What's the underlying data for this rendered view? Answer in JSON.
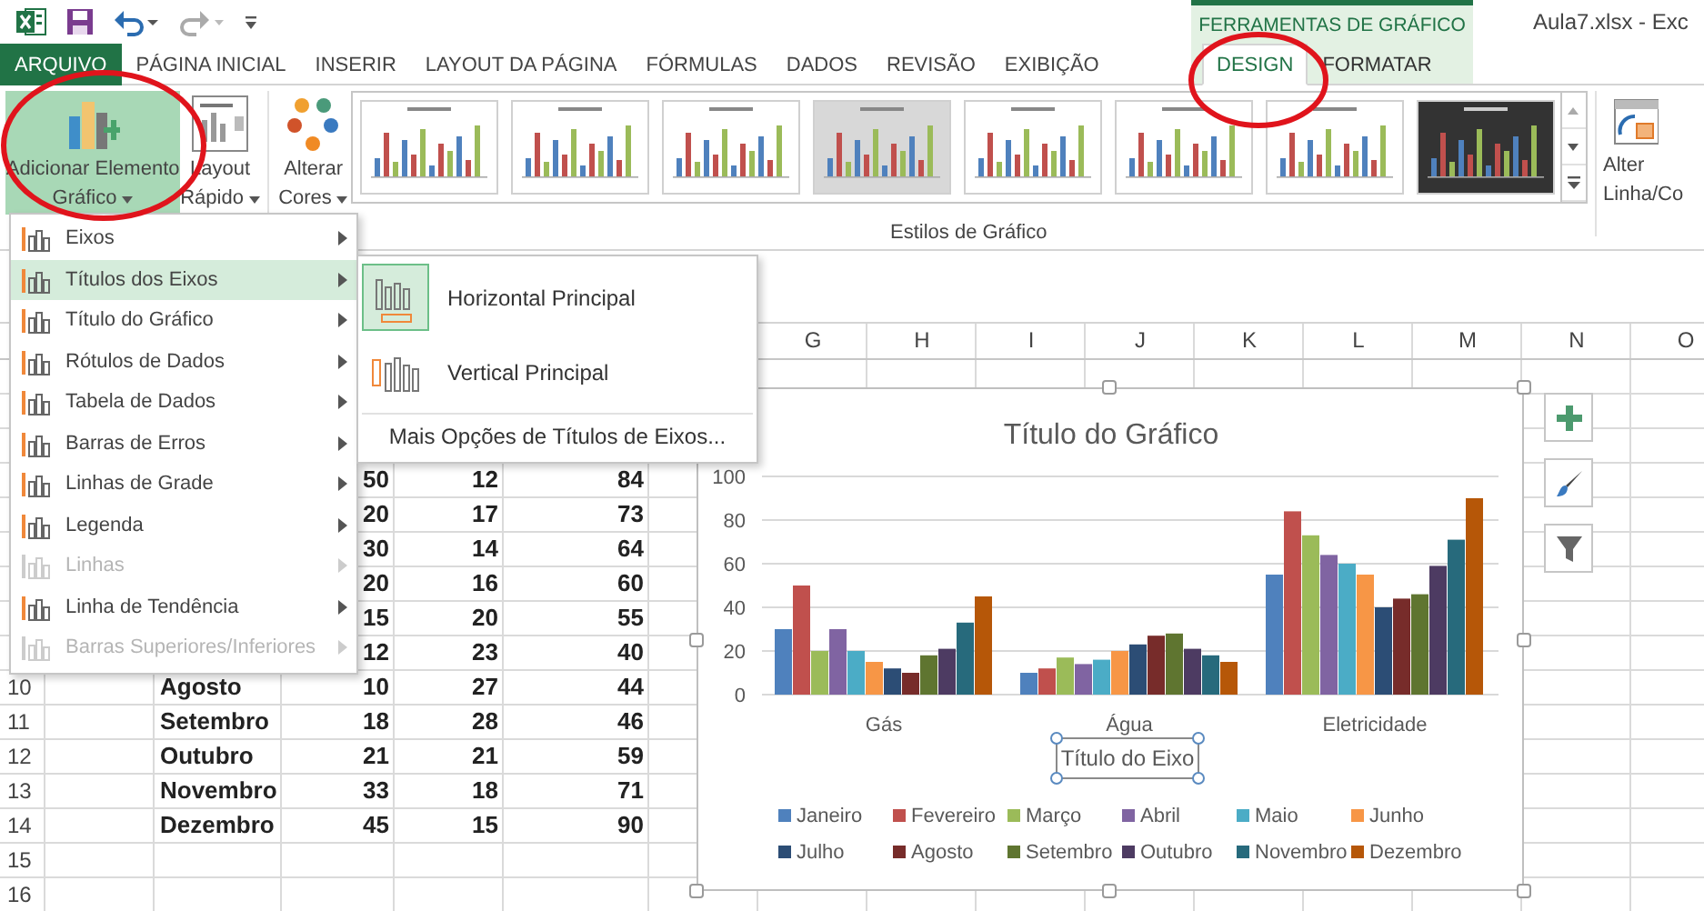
{
  "title_bar": {
    "context_header": "FERRAMENTAS DE GRÁFICO",
    "document_title": "Aula7.xlsx - Exc"
  },
  "tabs": [
    {
      "label": "ARQUIVO",
      "kind": "file",
      "selected": false
    },
    {
      "label": "PÁGINA INICIAL",
      "kind": "main",
      "selected": false
    },
    {
      "label": "INSERIR",
      "kind": "main",
      "selected": false
    },
    {
      "label": "LAYOUT DA PÁGINA",
      "kind": "main",
      "selected": false
    },
    {
      "label": "FÓRMULAS",
      "kind": "main",
      "selected": false
    },
    {
      "label": "DADOS",
      "kind": "main",
      "selected": false
    },
    {
      "label": "REVISÃO",
      "kind": "main",
      "selected": false
    },
    {
      "label": "EXIBIÇÃO",
      "kind": "main",
      "selected": false
    },
    {
      "label": "DESIGN",
      "kind": "context",
      "selected": true
    },
    {
      "label": "FORMATAR",
      "kind": "context",
      "selected": false
    }
  ],
  "ribbon": {
    "buttons": [
      {
        "kind": "add",
        "lines": [
          "Adicionar Elemento",
          "Gráfico"
        ],
        "pressed": true
      },
      {
        "kind": "layout",
        "lines": [
          "Layout",
          "Rápido"
        ],
        "pressed": false
      },
      {
        "kind": "colors",
        "lines": [
          "Alterar",
          "Cores"
        ],
        "pressed": false
      }
    ],
    "styles_gallery": [
      {
        "kind": "plain"
      },
      {
        "kind": "plain"
      },
      {
        "kind": "plain"
      },
      {
        "kind": "gray"
      },
      {
        "kind": "plain"
      },
      {
        "kind": "plain"
      },
      {
        "kind": "plain"
      },
      {
        "kind": "dark"
      }
    ],
    "group_label": "Estilos de Gráfico",
    "cut_button": {
      "lines": [
        "Alter",
        "Linha/Co"
      ]
    }
  },
  "chart_element_menu": {
    "items": [
      {
        "label": "Eixos",
        "selected": false,
        "disabled": false
      },
      {
        "label": "Títulos dos Eixos",
        "selected": true,
        "disabled": false
      },
      {
        "label": "Título do Gráfico",
        "selected": false,
        "disabled": false
      },
      {
        "label": "Rótulos de Dados",
        "selected": false,
        "disabled": false
      },
      {
        "label": "Tabela de Dados",
        "selected": false,
        "disabled": false
      },
      {
        "label": "Barras de Erros",
        "selected": false,
        "disabled": false
      },
      {
        "label": "Linhas de Grade",
        "selected": false,
        "disabled": false
      },
      {
        "label": "Legenda",
        "selected": false,
        "disabled": false
      },
      {
        "label": "Linhas",
        "selected": false,
        "disabled": true
      },
      {
        "label": "Linha de Tendência",
        "selected": false,
        "disabled": false
      },
      {
        "label": "Barras Superiores/Inferiores",
        "selected": false,
        "disabled": true
      }
    ]
  },
  "axis_titles_submenu": {
    "items": [
      {
        "label": "Horizontal Principal",
        "kind": "horizontal",
        "selected": true
      },
      {
        "label": "Vertical Principal",
        "kind": "vertical",
        "selected": false
      }
    ],
    "more_link": "Mais Opções de Títulos de Eixos..."
  },
  "sheet": {
    "columns": [
      "G",
      "H",
      "I",
      "J",
      "K",
      "L",
      "M",
      "N",
      "O"
    ],
    "rows": [
      {
        "values": [
          "50",
          "12",
          "84"
        ]
      },
      {
        "values": [
          "20",
          "17",
          "73"
        ]
      },
      {
        "values": [
          "30",
          "14",
          "64"
        ]
      },
      {
        "values": [
          "20",
          "16",
          "60"
        ]
      },
      {
        "values": [
          "15",
          "20",
          "55"
        ]
      },
      {
        "values": [
          "12",
          "23",
          "40"
        ]
      },
      {
        "number": "10",
        "month": "Agosto",
        "values": [
          "10",
          "27",
          "44"
        ]
      },
      {
        "number": "11",
        "month": "Setembro",
        "values": [
          "18",
          "28",
          "46"
        ]
      },
      {
        "number": "12",
        "month": "Outubro",
        "values": [
          "21",
          "21",
          "59"
        ]
      },
      {
        "number": "13",
        "month": "Novembro",
        "values": [
          "33",
          "18",
          "71"
        ]
      },
      {
        "number": "14",
        "month": "Dezembro",
        "values": [
          "45",
          "15",
          "90"
        ]
      },
      {
        "number": "15"
      },
      {
        "number": "16"
      }
    ]
  },
  "chart": {
    "chart_data": {
      "type": "bar",
      "grid": true,
      "legend": true,
      "title": "Título do Gráfico",
      "xlabel": "Título do Eixo",
      "categories": [
        "Gás",
        "Água",
        "Eletricidade"
      ],
      "ylim": [
        0,
        100
      ],
      "yticks": [
        {
          "value": 0,
          "label": "0"
        },
        {
          "value": 20,
          "label": "20"
        },
        {
          "value": 40,
          "label": "40"
        },
        {
          "value": 60,
          "label": "60"
        },
        {
          "value": 80,
          "label": "80"
        },
        {
          "value": 100,
          "label": "100"
        }
      ],
      "series": [
        {
          "name": "Janeiro",
          "color": "#4f81bd",
          "values": [
            30,
            10,
            55
          ]
        },
        {
          "name": "Fevereiro",
          "color": "#c0504d",
          "values": [
            50,
            12,
            84
          ]
        },
        {
          "name": "Março",
          "color": "#9bbb59",
          "values": [
            20,
            17,
            73
          ]
        },
        {
          "name": "Abril",
          "color": "#8064a2",
          "values": [
            30,
            14,
            64
          ]
        },
        {
          "name": "Maio",
          "color": "#4bacc6",
          "values": [
            20,
            16,
            60
          ]
        },
        {
          "name": "Junho",
          "color": "#f79646",
          "values": [
            15,
            20,
            55
          ]
        },
        {
          "name": "Julho",
          "color": "#2c4d75",
          "values": [
            12,
            23,
            40
          ]
        },
        {
          "name": "Agosto",
          "color": "#772c2a",
          "values": [
            10,
            27,
            44
          ]
        },
        {
          "name": "Setembro",
          "color": "#5f7530",
          "values": [
            18,
            28,
            46
          ]
        },
        {
          "name": "Outubro",
          "color": "#4d3b62",
          "values": [
            21,
            21,
            59
          ]
        },
        {
          "name": "Novembro",
          "color": "#276a7c",
          "values": [
            33,
            18,
            71
          ]
        },
        {
          "name": "Dezembro",
          "color": "#b65708",
          "values": [
            45,
            15,
            90
          ]
        }
      ]
    }
  }
}
